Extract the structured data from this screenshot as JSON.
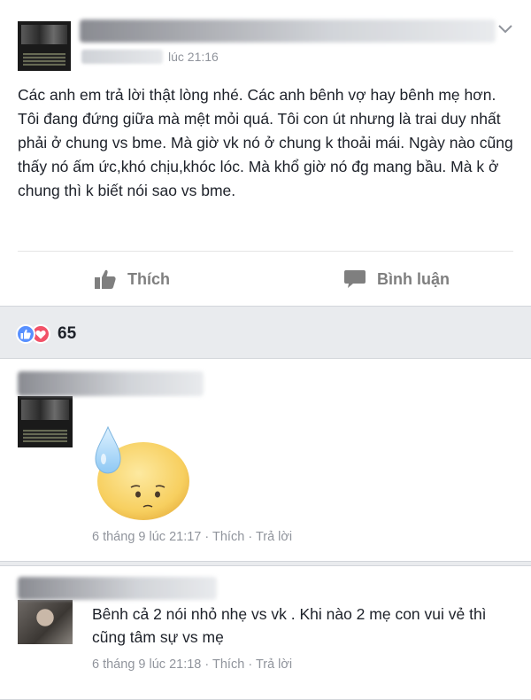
{
  "post": {
    "timestamp": "lúc 21:16",
    "text": "Các anh em trả lời thật lòng nhé. Các anh bênh vợ hay bênh mẹ hơn. Tôi đang đứng giữa mà mệt mỏi quá. Tôi con út nhưng là trai duy nhất phải ở chung vs bme. Mà giờ vk nó ở chung k thoải mái. Ngày nào cũng thấy nó ấm ức,khó chịu,khóc lóc. Mà khổ giờ nó đg mang bầu. Mà k ở chung thì k biết nói sao vs bme.",
    "actions": {
      "like_label": "Thích",
      "comment_label": "Bình luận"
    },
    "reactions": {
      "count": "65",
      "like_color": "#5890ff",
      "love_color": "#f25268"
    }
  },
  "comments": [
    {
      "sticker": "sweat-face-sticker",
      "time": "6 tháng 9 lúc 21:17",
      "sep1": "·",
      "like": "Thích",
      "sep2": "·",
      "reply": "Trả lời"
    },
    {
      "text": "Bênh cả 2 nói nhỏ nhẹ vs vk . Khi nào 2 mẹ con vui vẻ thì cũng tâm sự vs mẹ",
      "time": "6 tháng 9 lúc 21:18",
      "sep1": "·",
      "like": "Thích",
      "sep2": "·",
      "reply": "Trả lời"
    }
  ],
  "icons": {
    "menu": "chevron-down-icon",
    "like": "thumbs-up-icon",
    "comment": "speech-bubble-icon"
  }
}
